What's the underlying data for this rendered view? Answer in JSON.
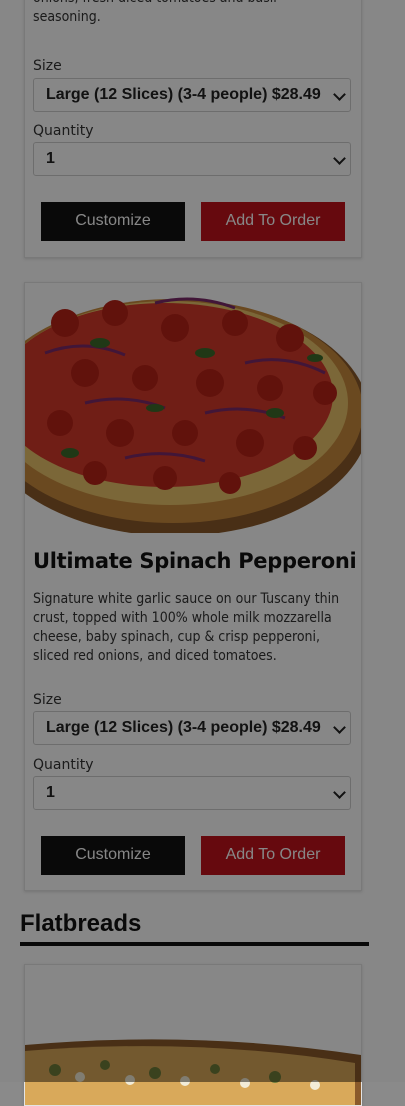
{
  "card1": {
    "desc_tail": "onions, fresh diced tomatoes and basil seasoning.",
    "size_label": "Size",
    "size_value": "Large (12 Slices) (3-4 people) $28.49",
    "qty_label": "Quantity",
    "qty_value": "1",
    "customize_label": "Customize",
    "add_label": "Add To Order"
  },
  "card2": {
    "title": "Ultimate Spinach Pepperoni",
    "desc": "Signature white garlic sauce on our Tuscany thin crust, topped with 100% whole milk mozzarella cheese, baby spinach, cup & crisp pepperoni, sliced red onions, and diced tomatoes.",
    "size_label": "Size",
    "size_value": "Large (12 Slices) (3-4 people) $28.49",
    "qty_label": "Quantity",
    "qty_value": "1",
    "customize_label": "Customize",
    "add_label": "Add To Order"
  },
  "section": {
    "title": "Flatbreads"
  },
  "colors": {
    "accent_red": "#c0121b",
    "dark_button": "#111111",
    "overlay": "rgba(0,0,0,0.47)"
  }
}
